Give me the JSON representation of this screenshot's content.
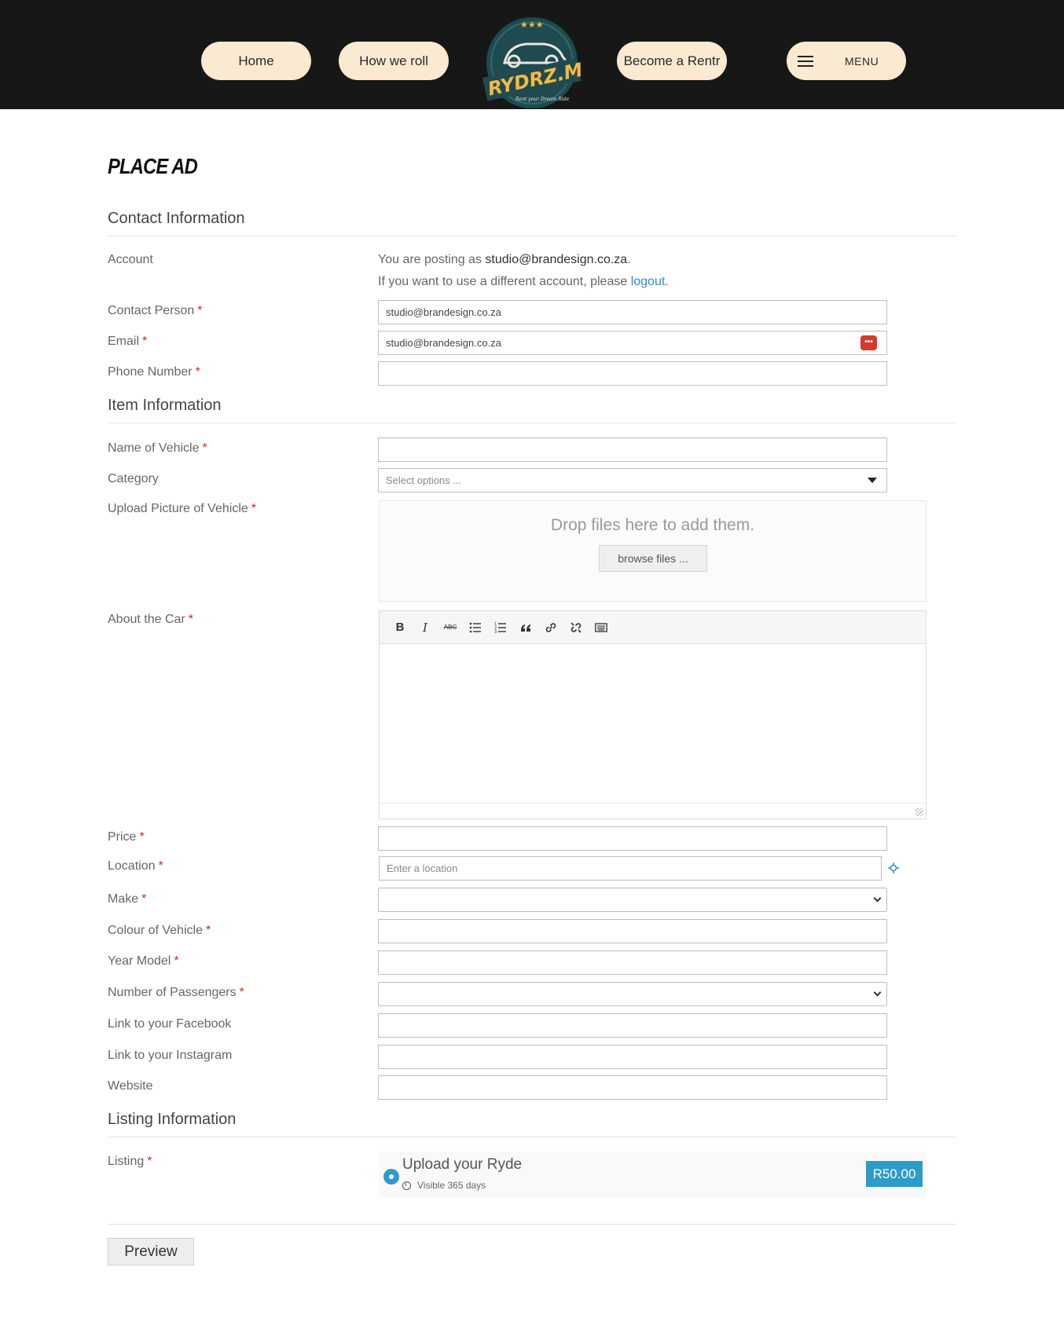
{
  "nav": {
    "home": "Home",
    "how_we_roll": "How we roll",
    "become_rentr": "Become a Rentr",
    "menu": "MENU",
    "logo_text": "RYDRZ.MOBI",
    "logo_tagline": "Rent your Dream Ride"
  },
  "page": {
    "title": "PLACE AD"
  },
  "contact": {
    "heading": "Contact Information",
    "account_label": "Account",
    "account_prefix": "You are posting as ",
    "account_email": "studio@brandesign.co.za",
    "account_dot": ".",
    "account_line2_prefix": "If you want to use a different account, please ",
    "logout_link": "logout",
    "account_line2_suffix": ".",
    "contact_person_label": "Contact Person",
    "contact_person_value": "studio@brandesign.co.za",
    "email_label": "Email",
    "email_value": "studio@brandesign.co.za",
    "phone_label": "Phone Number",
    "phone_value": "",
    "required_mark": "*"
  },
  "item": {
    "heading": "Item Information",
    "name_label": "Name of Vehicle",
    "category_label": "Category",
    "category_placeholder": "Select options ...",
    "upload_label": "Upload Picture of Vehicle",
    "drop_text": "Drop files here to add them.",
    "browse_label": "browse files ...",
    "about_label": "About the Car",
    "toolbar_bold": "B",
    "toolbar_italic": "I",
    "toolbar_strike": "ABC",
    "price_label": "Price",
    "location_label": "Location",
    "location_placeholder": "Enter a location",
    "make_label": "Make",
    "colour_label": "Colour of Vehicle",
    "year_label": "Year Model",
    "passengers_label": "Number of Passengers",
    "facebook_label": "Link to your Facebook",
    "instagram_label": "Link to your Instagram",
    "website_label": "Website"
  },
  "listing": {
    "heading": "Listing Information",
    "label": "Listing",
    "option_name": "Upload your Ryde",
    "option_visibility": "Visible 365 days",
    "option_price": "R50.00",
    "selected": true
  },
  "actions": {
    "preview": "Preview"
  },
  "colors": {
    "header_bg": "#171717",
    "pill_bg": "#fbead2",
    "accent_blue": "#2e9bc9",
    "required_red": "#d9261c",
    "link_blue": "#2d8ad6"
  }
}
